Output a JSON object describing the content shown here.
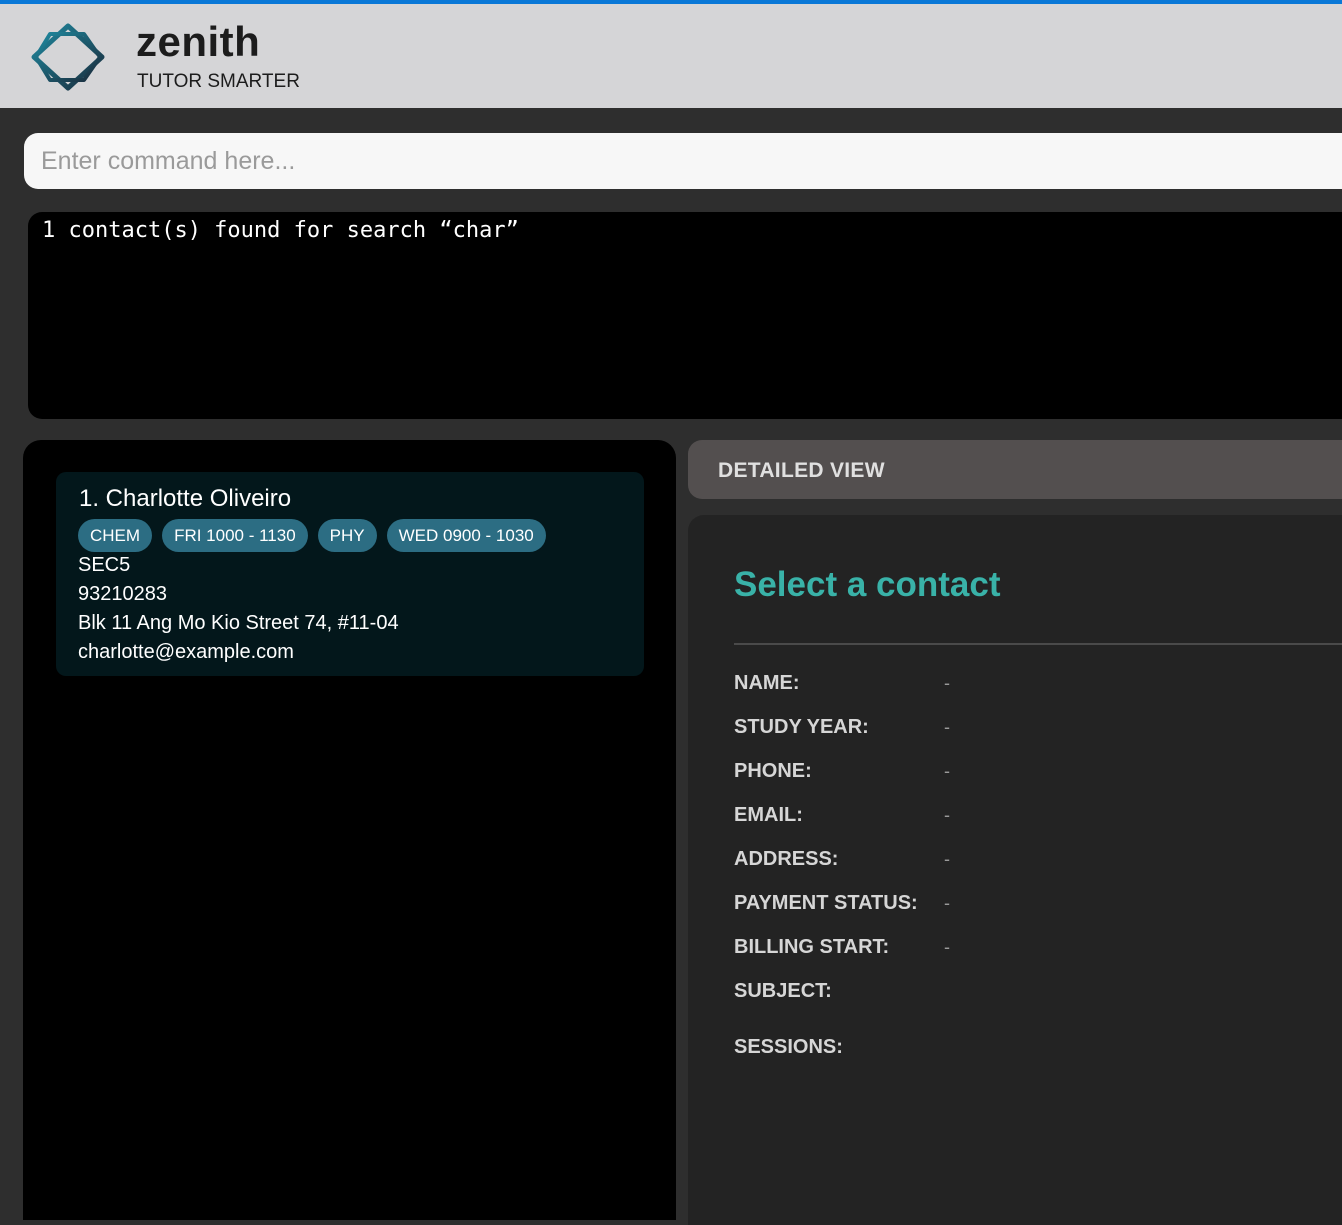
{
  "app": {
    "name": "zenith",
    "tagline": "TUTOR SMARTER"
  },
  "command": {
    "placeholder": "Enter command here...",
    "value": ""
  },
  "result": {
    "message": "1 contact(s) found for search “char”"
  },
  "person_list": [
    {
      "index_name": "1. Charlotte Oliveiro",
      "tags": [
        "CHEM",
        "FRI 1000 - 1130",
        "PHY",
        "WED 0900 - 1030"
      ],
      "study_year": "SEC5",
      "phone": "93210283",
      "address": "Blk 11 Ang Mo Kio Street 74, #11-04",
      "email": "charlotte@example.com"
    }
  ],
  "detail": {
    "header": "DETAILED VIEW",
    "title": "Select a contact",
    "fields": [
      {
        "label": "NAME:",
        "value": "-"
      },
      {
        "label": "STUDY YEAR:",
        "value": "-"
      },
      {
        "label": "PHONE:",
        "value": "-"
      },
      {
        "label": "EMAIL:",
        "value": "-"
      },
      {
        "label": "ADDRESS:",
        "value": "-"
      },
      {
        "label": "PAYMENT STATUS:",
        "value": "-"
      },
      {
        "label": "BILLING START:",
        "value": "-"
      },
      {
        "label": "SUBJECT:",
        "value": ""
      },
      {
        "label": "SESSIONS:",
        "value": ""
      }
    ]
  },
  "colors": {
    "accent_top_strip": "#0a78d7",
    "header_bg": "#d5d5d7",
    "tag_bg": "#2c6d83",
    "detail_title": "#39b2a8",
    "card_bg": "#03171b"
  },
  "icons": {
    "logo": "zenith-logo-icon"
  }
}
